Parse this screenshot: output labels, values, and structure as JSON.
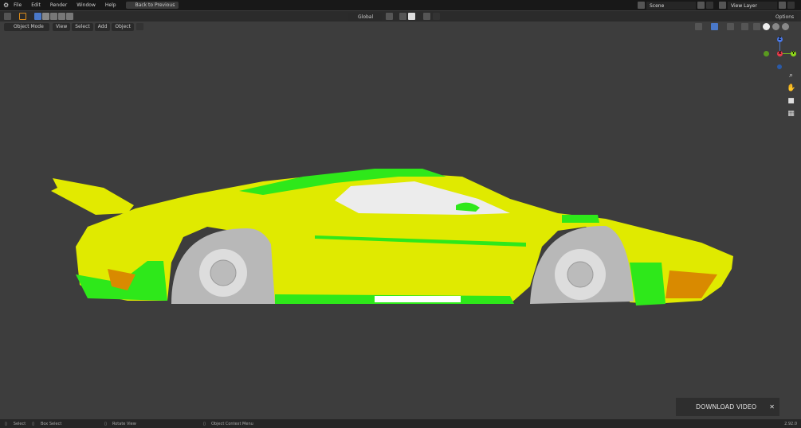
{
  "topbar": {
    "menus": [
      "File",
      "Edit",
      "Render",
      "Window",
      "Help"
    ],
    "back_button": "Back to Previous",
    "scene": "Scene",
    "view_layer": "View Layer"
  },
  "header": {
    "orientation": "Global",
    "options": "Options",
    "mode": "Object Mode",
    "menus": [
      "View",
      "Select",
      "Add",
      "Object"
    ]
  },
  "gizmo": {
    "z": "Z",
    "y": "Y",
    "x": "X"
  },
  "download": {
    "label": "DOWNLOAD VIDEO",
    "close": "✕"
  },
  "status": {
    "select": "Select",
    "box_select": "Box Select",
    "rotate": "Rotate View",
    "context": "Object Context Menu",
    "version": "2.92.0"
  },
  "colors": {
    "body": "#e6ee00",
    "accent": "#2ee81a",
    "viewport": "#3d3d3d"
  }
}
